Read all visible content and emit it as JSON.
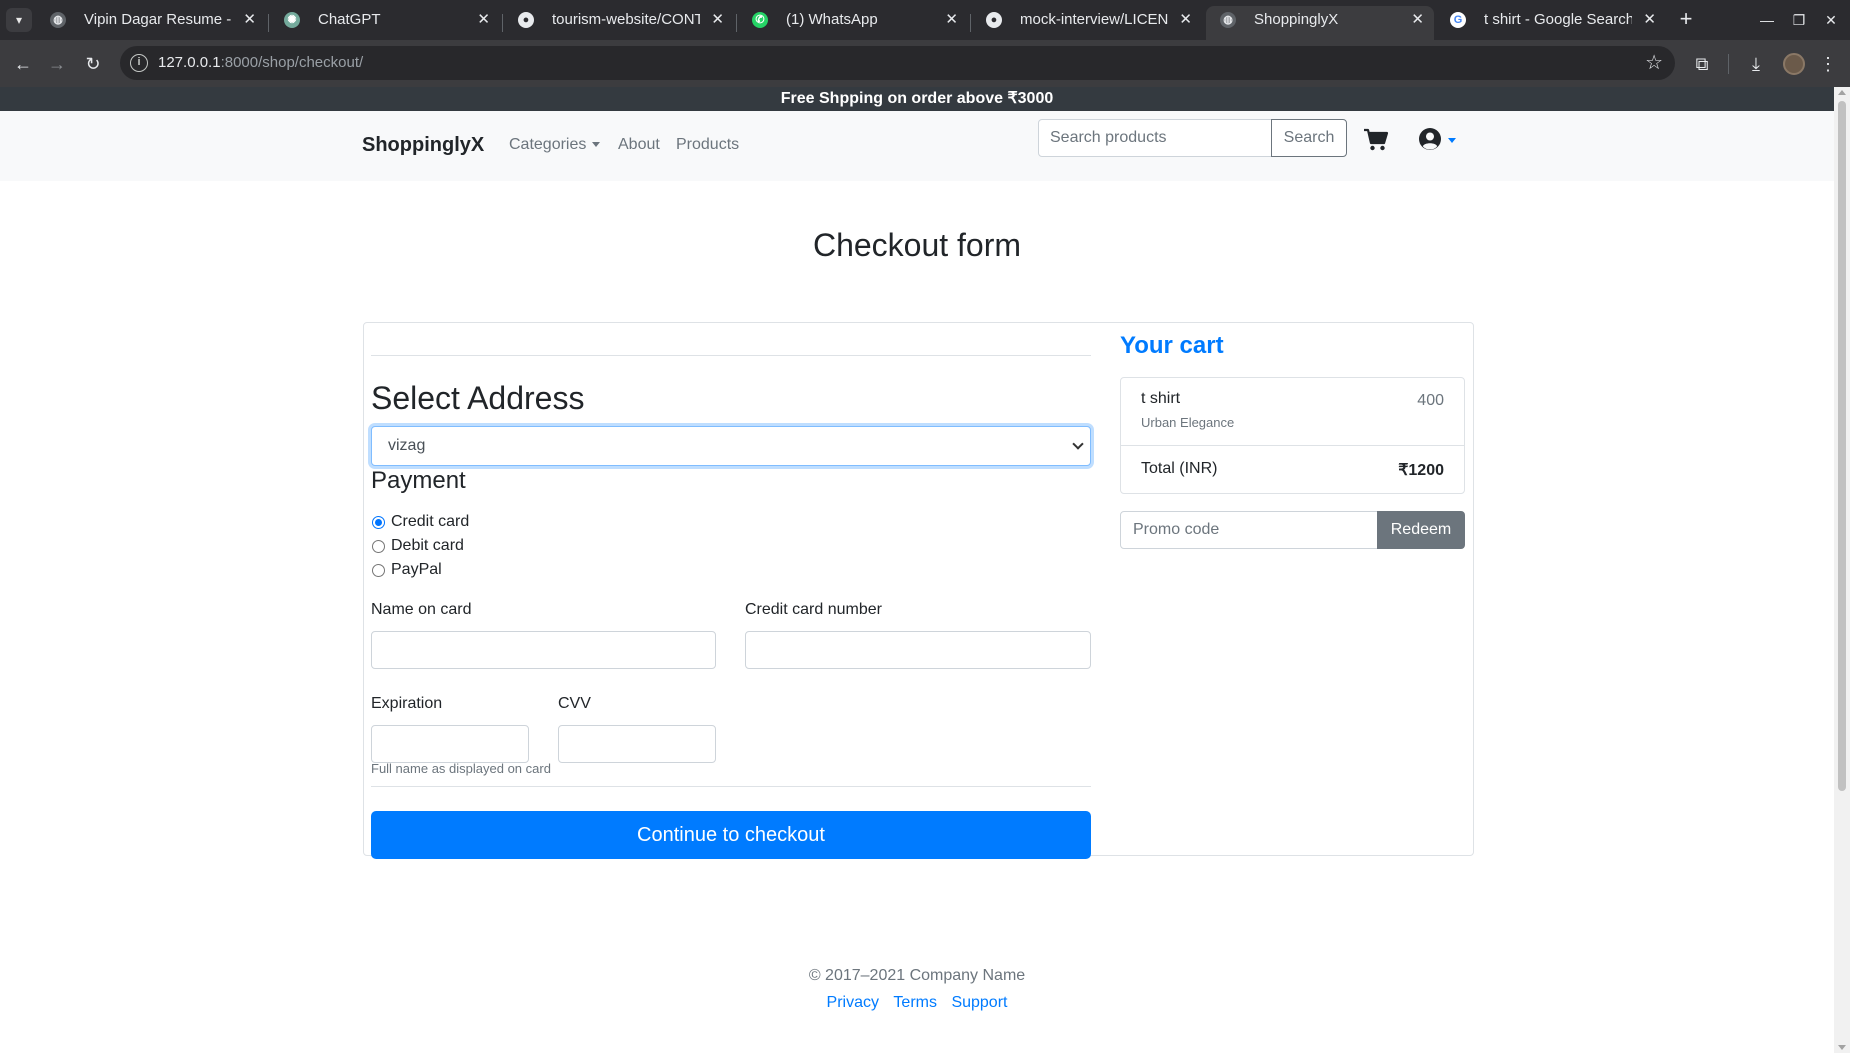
{
  "browser": {
    "tabs": [
      {
        "title": "Vipin Dagar Resume - G",
        "icon": "globe-icon",
        "active": false
      },
      {
        "title": "ChatGPT",
        "icon": "chatgpt-icon",
        "active": false
      },
      {
        "title": "tourism-website/CONTI",
        "icon": "github-icon",
        "active": false
      },
      {
        "title": "(1) WhatsApp",
        "icon": "whatsapp-icon",
        "active": false
      },
      {
        "title": "mock-interview/LICENS",
        "icon": "github-icon",
        "active": false
      },
      {
        "title": "ShoppinglyX",
        "icon": "globe-icon",
        "active": true
      },
      {
        "title": "t shirt - Google Search",
        "icon": "google-icon",
        "active": false
      }
    ],
    "url_host": "127.0.0.1",
    "url_rest": ":8000/shop/checkout/"
  },
  "site": {
    "promo_banner": "Free Shpping on order above ₹3000",
    "brand": "ShoppinglyX",
    "nav": {
      "categories": "Categories",
      "about": "About",
      "products": "Products"
    },
    "search_placeholder": "Search products",
    "search_button": "Search"
  },
  "checkout": {
    "title": "Checkout form",
    "select_address_heading": "Select Address",
    "selected_address": "vizag",
    "payment_heading": "Payment",
    "payment_methods": [
      {
        "label": "Credit card",
        "checked": true
      },
      {
        "label": "Debit card",
        "checked": false
      },
      {
        "label": "PayPal",
        "checked": false
      }
    ],
    "name_on_card_label": "Name on card",
    "name_on_card_help": "Full name as displayed on card",
    "card_number_label": "Credit card number",
    "expiration_label": "Expiration",
    "cvv_label": "CVV",
    "submit_button": "Continue to checkout"
  },
  "cart": {
    "heading": "Your cart",
    "items": [
      {
        "name": "t shirt",
        "brand": "Urban Elegance",
        "price": "400"
      }
    ],
    "total_label": "Total (INR)",
    "total_value": "₹1200",
    "promo_placeholder": "Promo code",
    "redeem_button": "Redeem"
  },
  "footer": {
    "copyright": "© 2017–2021 Company Name",
    "links": [
      "Privacy",
      "Terms",
      "Support"
    ]
  },
  "colors": {
    "primary": "#007bff",
    "secondary": "#6c757d",
    "dark_banner": "#343a40",
    "navbar_bg": "#f8f9fa"
  }
}
